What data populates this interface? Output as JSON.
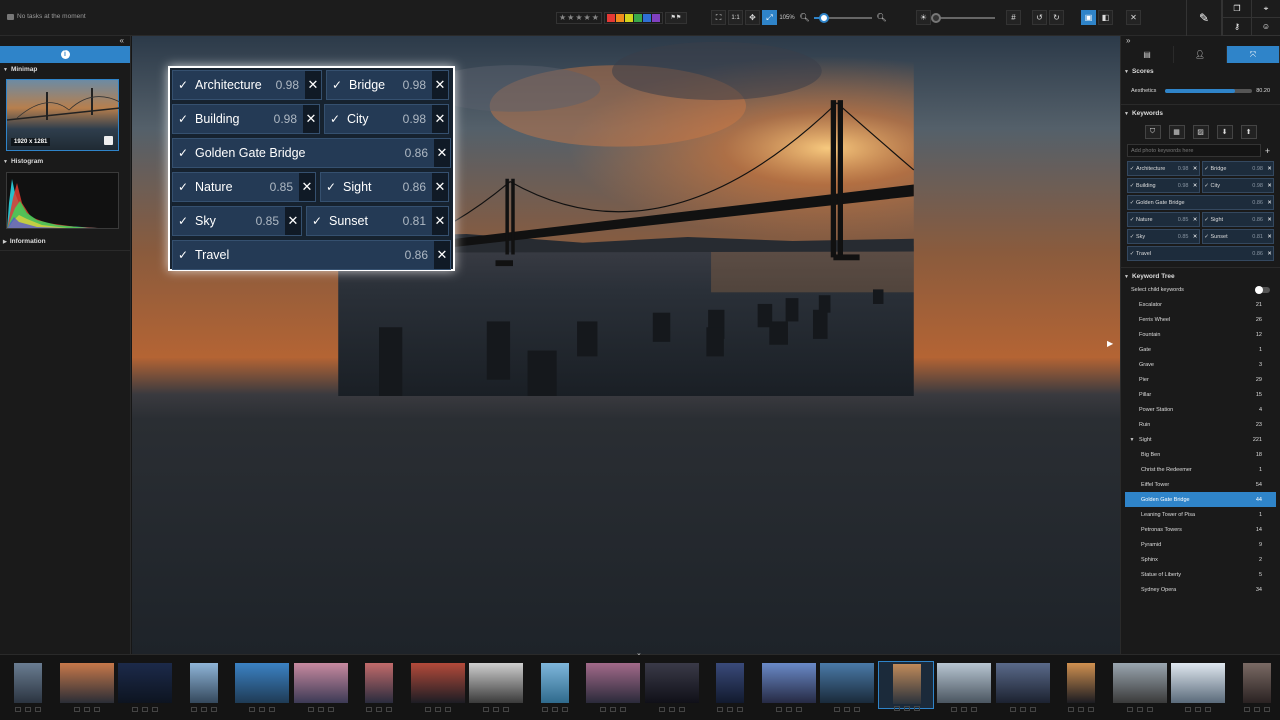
{
  "status": {
    "text": "No tasks at the moment"
  },
  "toolbar": {
    "stars": [
      "★",
      "★",
      "★",
      "★",
      "★"
    ],
    "colors": [
      "#e53935",
      "#f08c1c",
      "#d4d41c",
      "#3aa84a",
      "#2f6fd4",
      "#8040c0"
    ],
    "zoom_1to1": "1:1",
    "zoom_percent": "105%",
    "zoom_level": 0.18,
    "brightness_level": 0.05,
    "icons": [
      "fullscreen-icon",
      "one-to-one-icon",
      "fit-icon",
      "fill-icon",
      "zoom-out-icon",
      "zoom-in-icon",
      "sun-icon",
      "grid-icon",
      "rotate-left-icon",
      "rotate-right-icon",
      "single-view-icon",
      "compare-view-icon",
      "close-icon"
    ]
  },
  "topright": {
    "icons": [
      "edit-icon",
      "copy-icon",
      "location-icon",
      "key-icon",
      "face-icon",
      "people-icon",
      "search-icon"
    ]
  },
  "left": {
    "sections": {
      "minimap": "Minimap",
      "histogram": "Histogram",
      "information": "Information"
    },
    "minimap_dimensions": "1920 x 1281"
  },
  "overlay_keywords": [
    [
      {
        "label": "Architecture",
        "score": "0.98"
      },
      {
        "label": "Bridge",
        "score": "0.98"
      }
    ],
    [
      {
        "label": "Building",
        "score": "0.98"
      },
      {
        "label": "City",
        "score": "0.98"
      }
    ],
    [
      {
        "label": "Golden Gate Bridge",
        "score": "0.86"
      }
    ],
    [
      {
        "label": "Nature",
        "score": "0.85"
      },
      {
        "label": "Sight",
        "score": "0.86"
      }
    ],
    [
      {
        "label": "Sky",
        "score": "0.85"
      },
      {
        "label": "Sunset",
        "score": "0.81"
      }
    ],
    [
      {
        "label": "Travel",
        "score": "0.86"
      }
    ]
  ],
  "right": {
    "scores": {
      "title": "Scores",
      "aesthetics_label": "Aesthetics",
      "aesthetics_value": "80.20",
      "aesthetics_fraction": 0.802
    },
    "keywords": {
      "title": "Keywords",
      "placeholder": "Add photo keywords here"
    },
    "keyword_tree": {
      "title": "Keyword Tree",
      "select_child": "Select child keywords",
      "items": [
        {
          "label": "Escalator",
          "count": "21",
          "level": 0
        },
        {
          "label": "Ferris Wheel",
          "count": "26",
          "level": 0
        },
        {
          "label": "Fountain",
          "count": "12",
          "level": 0
        },
        {
          "label": "Gate",
          "count": "1",
          "level": 0
        },
        {
          "label": "Grave",
          "count": "3",
          "level": 0
        },
        {
          "label": "Pier",
          "count": "29",
          "level": 0
        },
        {
          "label": "Pillar",
          "count": "15",
          "level": 0
        },
        {
          "label": "Power Station",
          "count": "4",
          "level": 0
        },
        {
          "label": "Ruin",
          "count": "23",
          "level": 0
        },
        {
          "label": "Sight",
          "count": "221",
          "level": 0,
          "expanded": true
        },
        {
          "label": "Big Ben",
          "count": "18",
          "level": 1
        },
        {
          "label": "Christ the Redeemer",
          "count": "1",
          "level": 1
        },
        {
          "label": "Eiffel Tower",
          "count": "54",
          "level": 1
        },
        {
          "label": "Golden Gate Bridge",
          "count": "44",
          "level": 1,
          "selected": true
        },
        {
          "label": "Leaning Tower of Pisa",
          "count": "1",
          "level": 1
        },
        {
          "label": "Petronas Towers",
          "count": "14",
          "level": 1
        },
        {
          "label": "Pyramid",
          "count": "9",
          "level": 1
        },
        {
          "label": "Sphinx",
          "count": "2",
          "level": 1
        },
        {
          "label": "Statue of Liberty",
          "count": "5",
          "level": 1
        },
        {
          "label": "Sydney Opera",
          "count": "34",
          "level": 1
        }
      ]
    }
  },
  "filmstrip": {
    "thumbs": [
      {
        "c1": "#6a7d92",
        "c2": "#2b3440"
      },
      {
        "c1": "#c7784a",
        "c2": "#2a2d36"
      },
      {
        "c1": "#1c2a4a",
        "c2": "#0d1420"
      },
      {
        "c1": "#8fb5d8",
        "c2": "#34485c"
      },
      {
        "c1": "#3b82c4",
        "c2": "#1f3b55"
      },
      {
        "c1": "#c88aa0",
        "c2": "#3c3a55"
      },
      {
        "c1": "#c26b6b",
        "c2": "#2a2c3e"
      },
      {
        "c1": "#b34a3a",
        "c2": "#1d1d24"
      },
      {
        "c1": "#cfcfcf",
        "c2": "#3a3a3a"
      },
      {
        "c1": "#7fb7dc",
        "c2": "#2f6a8c"
      },
      {
        "c1": "#a26a8a",
        "c2": "#2a2a3a"
      },
      {
        "c1": "#3a3a48",
        "c2": "#101018"
      },
      {
        "c1": "#3a4a7a",
        "c2": "#121a2e"
      },
      {
        "c1": "#6a8ac8",
        "c2": "#262a44"
      },
      {
        "c1": "#4a7aa8",
        "c2": "#1a2a3a"
      },
      {
        "c1": "#c08a5a",
        "c2": "#2a323c",
        "selected": true
      },
      {
        "c1": "#b8c6d2",
        "c2": "#4a5560"
      },
      {
        "c1": "#5a6a8a",
        "c2": "#1c2230"
      },
      {
        "c1": "#d09050",
        "c2": "#1c1c22"
      },
      {
        "c1": "#9aa6b0",
        "c2": "#3a3a3a"
      },
      {
        "c1": "#e0e8f0",
        "c2": "#5a6a7a"
      },
      {
        "c1": "#7a6a64",
        "c2": "#2a2222"
      }
    ]
  }
}
